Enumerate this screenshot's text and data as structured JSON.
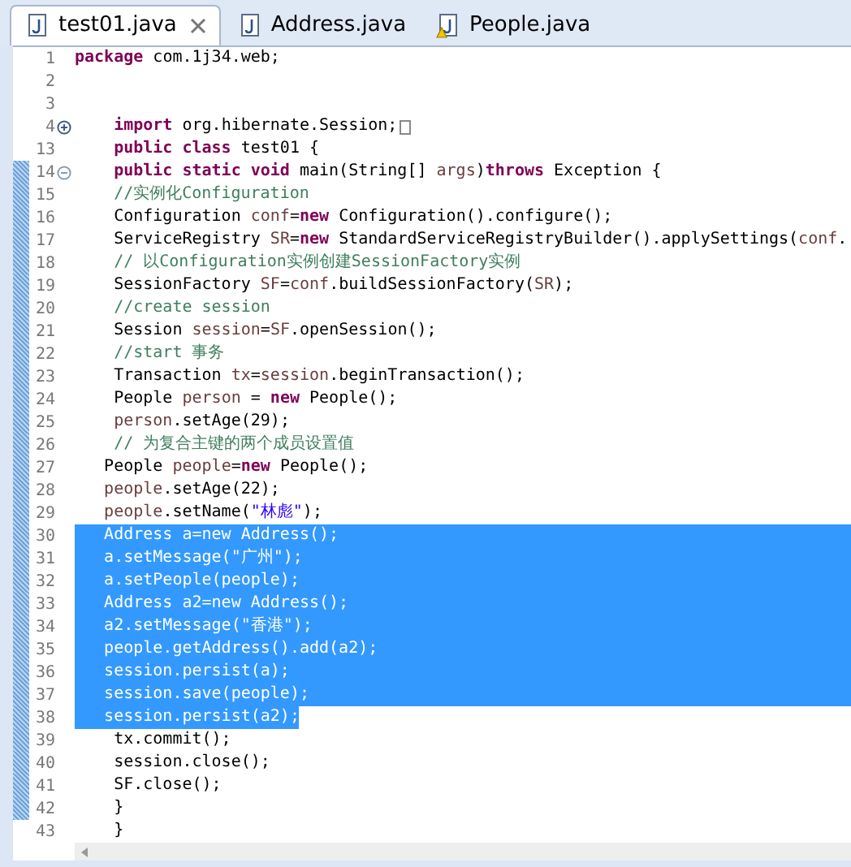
{
  "tabs": [
    {
      "label": "test01.java",
      "selected": true,
      "closable": true,
      "warning": false
    },
    {
      "label": "Address.java",
      "selected": false,
      "closable": false,
      "warning": false
    },
    {
      "label": "People.java",
      "selected": false,
      "closable": false,
      "warning": true
    }
  ],
  "lines": [
    {
      "number": "1",
      "changed": false,
      "selected": false,
      "tokens": [
        {
          "kind": "keyword",
          "text": "package"
        },
        {
          "kind": "plain",
          "text": " com.1j34.web;"
        }
      ]
    },
    {
      "number": "2",
      "changed": false,
      "selected": false
    },
    {
      "number": "3",
      "changed": false,
      "selected": false
    },
    {
      "number": "4",
      "changed": false,
      "selected": false,
      "collapsed": true,
      "tokens": [
        {
          "kind": "keyword",
          "text": "    import"
        },
        {
          "kind": "plain",
          "text": " org.hibernate.Session;"
        }
      ]
    },
    {
      "number": "13",
      "changed": false,
      "selected": false,
      "tokens": [
        {
          "kind": "keyword",
          "text": "    public class"
        },
        {
          "kind": "plain",
          "text": " test01 {"
        }
      ]
    },
    {
      "number": "14",
      "changed": true,
      "selected": false,
      "collapsed": false,
      "tokens": [
        {
          "kind": "keyword",
          "text": "    public static void"
        },
        {
          "kind": "plain",
          "text": " main(String[] "
        },
        {
          "kind": "variable",
          "text": "args"
        },
        {
          "kind": "plain",
          "text": ")"
        },
        {
          "kind": "keyword",
          "text": "throws"
        },
        {
          "kind": "plain",
          "text": " Exception {"
        }
      ]
    },
    {
      "number": "15",
      "changed": true,
      "selected": false,
      "tokens": [
        {
          "kind": "comment",
          "text": "    //实例化Configuration"
        }
      ]
    },
    {
      "number": "16",
      "changed": true,
      "selected": false,
      "tokens": [
        {
          "kind": "plain",
          "text": "    Configuration "
        },
        {
          "kind": "variable",
          "text": "conf"
        },
        {
          "kind": "plain",
          "text": "="
        },
        {
          "kind": "keyword",
          "text": "new"
        },
        {
          "kind": "plain",
          "text": " Configuration().configure();"
        }
      ]
    },
    {
      "number": "17",
      "changed": true,
      "selected": false,
      "tokens": [
        {
          "kind": "plain",
          "text": "    ServiceRegistry "
        },
        {
          "kind": "variable",
          "text": "SR"
        },
        {
          "kind": "plain",
          "text": "="
        },
        {
          "kind": "keyword",
          "text": "new"
        },
        {
          "kind": "plain",
          "text": " StandardServiceRegistryBuilder().applySettings("
        },
        {
          "kind": "variable",
          "text": "conf"
        },
        {
          "kind": "plain",
          "text": "."
        }
      ]
    },
    {
      "number": "18",
      "changed": true,
      "selected": false,
      "tokens": [
        {
          "kind": "comment",
          "text": "    // 以Configuration实例创建SessionFactory实例"
        }
      ]
    },
    {
      "number": "19",
      "changed": true,
      "selected": false,
      "tokens": [
        {
          "kind": "plain",
          "text": "    SessionFactory "
        },
        {
          "kind": "variable",
          "text": "SF"
        },
        {
          "kind": "plain",
          "text": "="
        },
        {
          "kind": "variable",
          "text": "conf"
        },
        {
          "kind": "plain",
          "text": ".buildSessionFactory("
        },
        {
          "kind": "variable",
          "text": "SR"
        },
        {
          "kind": "plain",
          "text": ");"
        }
      ]
    },
    {
      "number": "20",
      "changed": true,
      "selected": false,
      "tokens": [
        {
          "kind": "comment",
          "text": "    //create session"
        }
      ]
    },
    {
      "number": "21",
      "changed": true,
      "selected": false,
      "tokens": [
        {
          "kind": "plain",
          "text": "    Session "
        },
        {
          "kind": "variable",
          "text": "session"
        },
        {
          "kind": "plain",
          "text": "="
        },
        {
          "kind": "variable",
          "text": "SF"
        },
        {
          "kind": "plain",
          "text": ".openSession();"
        }
      ]
    },
    {
      "number": "22",
      "changed": true,
      "selected": false,
      "tokens": [
        {
          "kind": "comment",
          "text": "    //start 事务"
        }
      ]
    },
    {
      "number": "23",
      "changed": true,
      "selected": false,
      "tokens": [
        {
          "kind": "plain",
          "text": "    Transaction "
        },
        {
          "kind": "variable",
          "text": "tx"
        },
        {
          "kind": "plain",
          "text": "="
        },
        {
          "kind": "variable",
          "text": "session"
        },
        {
          "kind": "plain",
          "text": ".beginTransaction();"
        }
      ]
    },
    {
      "number": "24",
      "changed": true,
      "selected": false,
      "tokens": [
        {
          "kind": "plain",
          "text": "    People "
        },
        {
          "kind": "variable",
          "text": "person"
        },
        {
          "kind": "plain",
          "text": " = "
        },
        {
          "kind": "keyword",
          "text": "new"
        },
        {
          "kind": "plain",
          "text": " People();"
        }
      ]
    },
    {
      "number": "25",
      "changed": true,
      "selected": false,
      "tokens": [
        {
          "kind": "variable",
          "text": "    person"
        },
        {
          "kind": "plain",
          "text": ".setAge(29);"
        }
      ]
    },
    {
      "number": "26",
      "changed": true,
      "selected": false,
      "tokens": [
        {
          "kind": "comment",
          "text": "    // 为复合主键的两个成员设置值"
        }
      ]
    },
    {
      "number": "27",
      "changed": true,
      "selected": false,
      "tokens": [
        {
          "kind": "plain",
          "text": "   People "
        },
        {
          "kind": "variable",
          "text": "people"
        },
        {
          "kind": "plain",
          "text": "="
        },
        {
          "kind": "keyword",
          "text": "new"
        },
        {
          "kind": "plain",
          "text": " People();"
        }
      ]
    },
    {
      "number": "28",
      "changed": true,
      "selected": false,
      "tokens": [
        {
          "kind": "variable",
          "text": "   people"
        },
        {
          "kind": "plain",
          "text": ".setAge(22);"
        }
      ]
    },
    {
      "number": "29",
      "changed": true,
      "selected": false,
      "tokens": [
        {
          "kind": "variable",
          "text": "   people"
        },
        {
          "kind": "plain",
          "text": ".setName("
        },
        {
          "kind": "string",
          "text": "\"林彪\""
        },
        {
          "kind": "plain",
          "text": ");"
        }
      ]
    },
    {
      "number": "30",
      "changed": true,
      "selected": true,
      "text": "   Address a=new Address();"
    },
    {
      "number": "31",
      "changed": true,
      "selected": true,
      "text": "   a.setMessage(\"广州\");"
    },
    {
      "number": "32",
      "changed": true,
      "selected": true,
      "text": "   a.setPeople(people);"
    },
    {
      "number": "33",
      "changed": true,
      "selected": true,
      "text": "   Address a2=new Address();"
    },
    {
      "number": "34",
      "changed": true,
      "selected": true,
      "text": "   a2.setMessage(\"香港\");"
    },
    {
      "number": "35",
      "changed": true,
      "selected": true,
      "text": "   people.getAddress().add(a2);"
    },
    {
      "number": "36",
      "changed": true,
      "selected": true,
      "text": "   session.persist(a);"
    },
    {
      "number": "37",
      "changed": true,
      "selected": true,
      "text": "   session.save(people);"
    },
    {
      "number": "38",
      "changed": true,
      "selected": true,
      "text": "   session.persist(a2);"
    },
    {
      "number": "39",
      "changed": true,
      "selected": false,
      "text": "    tx.commit();"
    },
    {
      "number": "40",
      "changed": true,
      "selected": false,
      "text": "    session.close();"
    },
    {
      "number": "41",
      "changed": true,
      "selected": false,
      "text": "    SF.close();"
    },
    {
      "number": "42",
      "changed": true,
      "selected": false,
      "text": "    }"
    },
    {
      "number": "43",
      "changed": false,
      "selected": false,
      "text": "    }"
    }
  ]
}
